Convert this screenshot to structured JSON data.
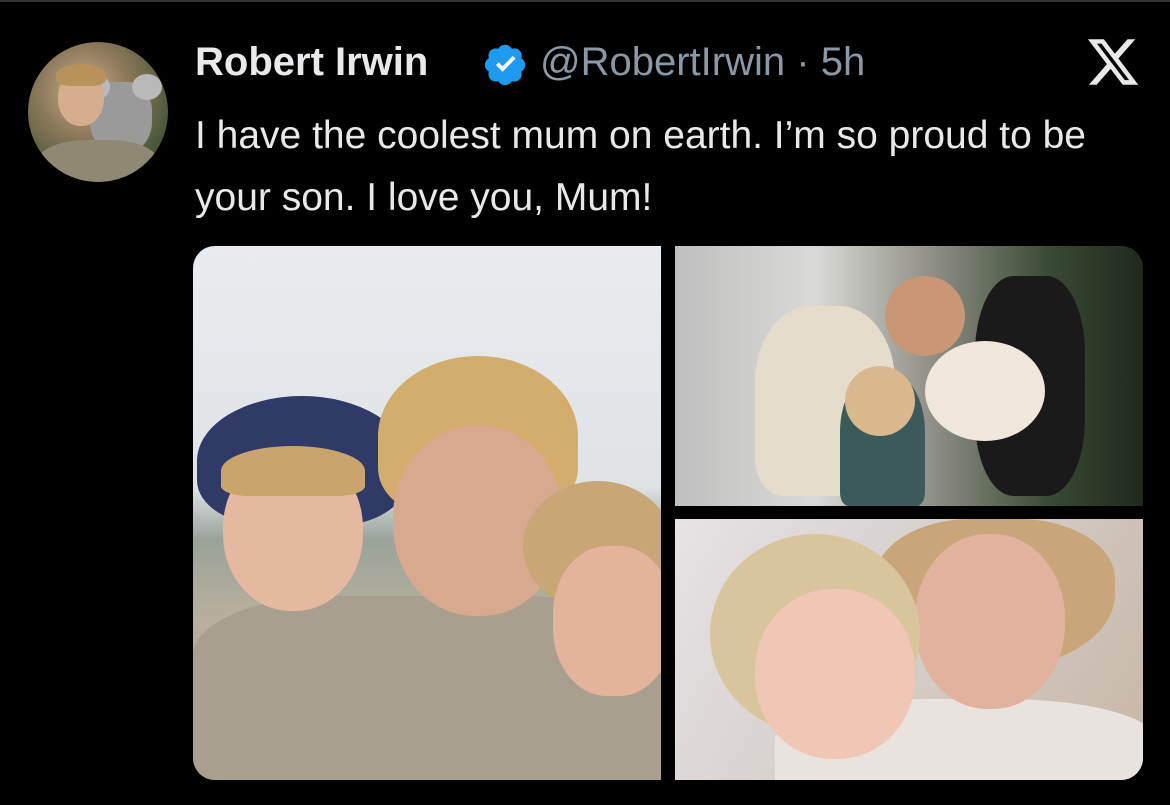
{
  "colors": {
    "background": "#000000",
    "text": "#e7e9ea",
    "muted": "#8b98a5",
    "verified_badge": "#1d9bf0"
  },
  "tweet": {
    "display_name": "Robert Irwin",
    "verified_icon": "verified-badge-icon",
    "handle": "@RobertIrwin",
    "separator": "·",
    "time": "5h",
    "text": "I have the coolest mum on earth. I’m so proud to be your son. I love you, Mum!"
  },
  "brand": {
    "logo_icon": "x-logo-icon"
  },
  "media": {
    "photos": [
      {
        "slot": "left",
        "label": "photo-1"
      },
      {
        "slot": "top-right",
        "label": "photo-2"
      },
      {
        "slot": "bottom-right",
        "label": "photo-3"
      }
    ]
  }
}
